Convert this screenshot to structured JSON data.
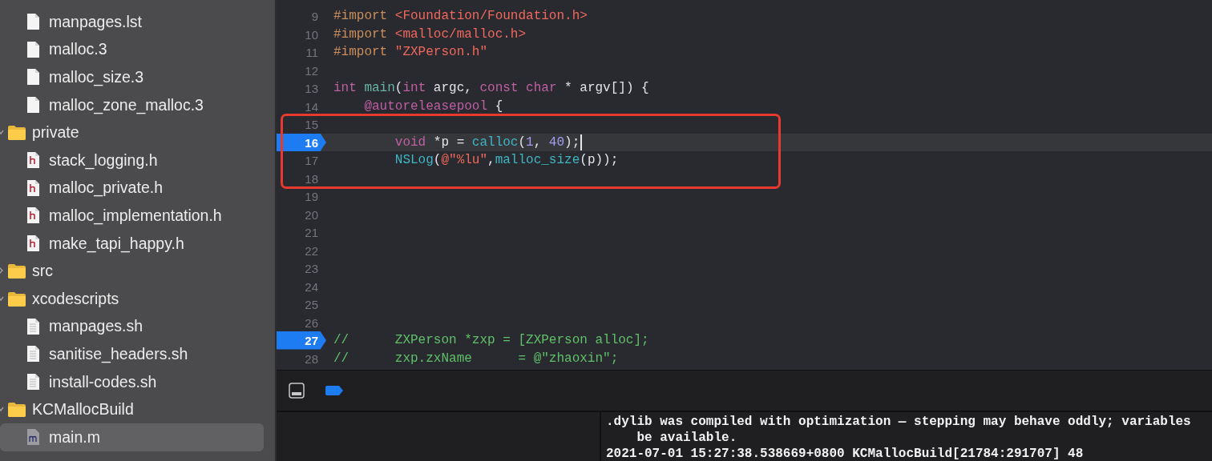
{
  "navigator": {
    "items": [
      {
        "kind": "doc",
        "label": "manpages.lst",
        "selected": false
      },
      {
        "kind": "doc",
        "label": "malloc.3",
        "selected": false
      },
      {
        "kind": "doc",
        "label": "malloc_size.3",
        "selected": false
      },
      {
        "kind": "doc",
        "label": "malloc_zone_malloc.3",
        "selected": false
      },
      {
        "kind": "folder",
        "label": "private",
        "expanded": true,
        "selected": false,
        "children": [
          {
            "kind": "header",
            "label": "stack_logging.h",
            "selected": false
          },
          {
            "kind": "header",
            "label": "malloc_private.h",
            "selected": false
          },
          {
            "kind": "header",
            "label": "malloc_implementation.h",
            "selected": false
          },
          {
            "kind": "header",
            "label": "make_tapi_happy.h",
            "selected": false
          }
        ]
      },
      {
        "kind": "folder",
        "label": "src",
        "expanded": false,
        "selected": false
      },
      {
        "kind": "folder",
        "label": "xcodescripts",
        "expanded": true,
        "selected": false,
        "children": [
          {
            "kind": "script",
            "label": "manpages.sh",
            "selected": false
          },
          {
            "kind": "script",
            "label": "sanitise_headers.sh",
            "selected": false
          },
          {
            "kind": "script",
            "label": "install-codes.sh",
            "selected": false
          }
        ]
      },
      {
        "kind": "folder",
        "label": "KCMallocBuild",
        "expanded": true,
        "selected": false,
        "children": [
          {
            "kind": "source",
            "label": "main.m",
            "selected": true
          }
        ]
      }
    ]
  },
  "editor": {
    "lines": [
      {
        "number": "9",
        "breakpoint": false,
        "current": false,
        "tokens": [
          {
            "kind": "preproc",
            "text": "#import "
          },
          {
            "kind": "string",
            "text": "<Foundation/Foundation.h>"
          }
        ]
      },
      {
        "number": "10",
        "breakpoint": false,
        "current": false,
        "tokens": [
          {
            "kind": "preproc",
            "text": "#import "
          },
          {
            "kind": "string",
            "text": "<malloc/malloc.h>"
          }
        ]
      },
      {
        "number": "11",
        "breakpoint": false,
        "current": false,
        "tokens": [
          {
            "kind": "preproc",
            "text": "#import "
          },
          {
            "kind": "string",
            "text": "\"ZXPerson.h\""
          }
        ]
      },
      {
        "number": "12",
        "breakpoint": false,
        "current": false
      },
      {
        "number": "13",
        "breakpoint": false,
        "current": false,
        "tokens": [
          {
            "kind": "keyword",
            "text": "int"
          },
          {
            "kind": "function",
            "text": " main"
          },
          {
            "kind": "plain",
            "text": "("
          },
          {
            "kind": "keyword",
            "text": "int"
          },
          {
            "kind": "plain",
            "text": " argc, "
          },
          {
            "kind": "keyword",
            "text": "const"
          },
          {
            "kind": "keyword",
            "text": " char"
          },
          {
            "kind": "plain",
            "text": " * argv[]) {"
          }
        ]
      },
      {
        "number": "14",
        "breakpoint": false,
        "current": false,
        "tokens": [
          {
            "kind": "keyword",
            "text": "    @autoreleasepool"
          },
          {
            "kind": "plain",
            "text": " {"
          }
        ]
      },
      {
        "number": "15",
        "breakpoint": false,
        "current": false
      },
      {
        "number": "16",
        "breakpoint": true,
        "current": true,
        "cursor": true,
        "tokens": [
          {
            "kind": "keyword",
            "text": "        void"
          },
          {
            "kind": "plain",
            "text": " *p = "
          },
          {
            "kind": "library",
            "text": "calloc"
          },
          {
            "kind": "plain",
            "text": "("
          },
          {
            "kind": "number",
            "text": "1"
          },
          {
            "kind": "plain",
            "text": ", "
          },
          {
            "kind": "number",
            "text": "40"
          },
          {
            "kind": "plain",
            "text": ");"
          }
        ]
      },
      {
        "number": "17",
        "breakpoint": false,
        "current": false,
        "tokens": [
          {
            "kind": "library",
            "text": "        NSLog"
          },
          {
            "kind": "plain",
            "text": "("
          },
          {
            "kind": "string",
            "text": "@\"%lu\""
          },
          {
            "kind": "plain",
            "text": ","
          },
          {
            "kind": "library",
            "text": "malloc_size"
          },
          {
            "kind": "plain",
            "text": "(p));"
          }
        ]
      },
      {
        "number": "18",
        "breakpoint": false,
        "current": false
      },
      {
        "number": "19",
        "breakpoint": false,
        "current": false
      },
      {
        "number": "20",
        "breakpoint": false,
        "current": false
      },
      {
        "number": "21",
        "breakpoint": false,
        "current": false
      },
      {
        "number": "22",
        "breakpoint": false,
        "current": false
      },
      {
        "number": "23",
        "breakpoint": false,
        "current": false
      },
      {
        "number": "24",
        "breakpoint": false,
        "current": false
      },
      {
        "number": "25",
        "breakpoint": false,
        "current": false
      },
      {
        "number": "26",
        "breakpoint": false,
        "current": false
      },
      {
        "number": "27",
        "breakpoint": true,
        "current": false,
        "tokens": [
          {
            "kind": "comment",
            "text": "//      ZXPerson *zxp = [ZXPerson alloc];"
          }
        ]
      },
      {
        "number": "28",
        "breakpoint": false,
        "current": false,
        "tokens": [
          {
            "kind": "comment",
            "text": "//      zxp.zxName      = @\"zhaoxin\";"
          }
        ]
      }
    ]
  },
  "debug_bar": {
    "breakpoints_enabled": true
  },
  "console": {
    "lines": [
      ".dylib was compiled with optimization — stepping may behave oddly; variables",
      "    be available.",
      "2021-07-01 15:27:38.538669+0800 KCMallocBuild[21784:291707] 48"
    ]
  }
}
